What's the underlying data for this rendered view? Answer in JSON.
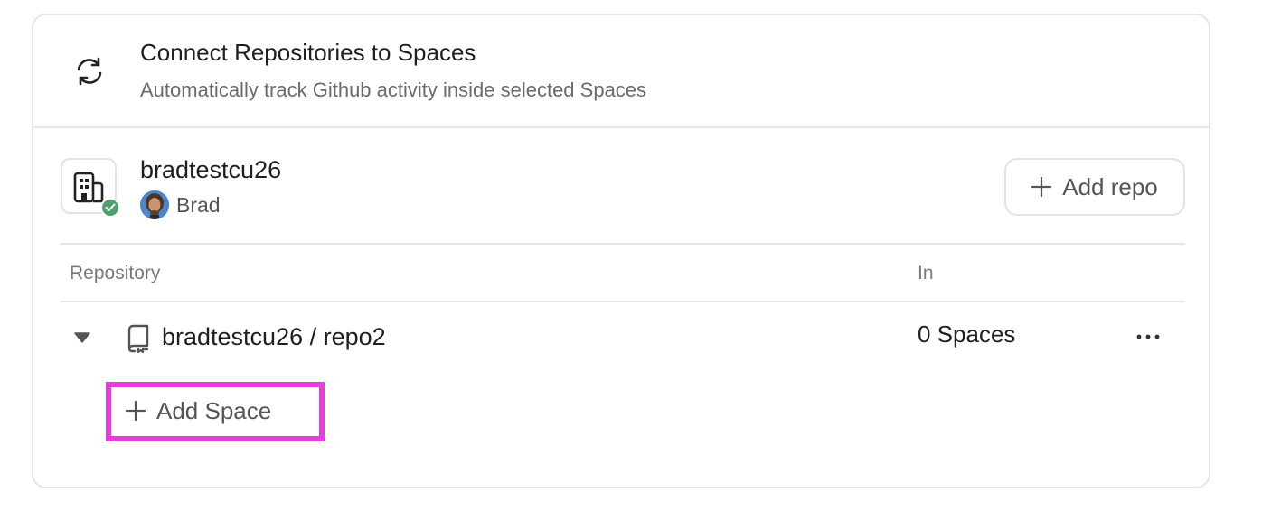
{
  "header": {
    "title": "Connect Repositories to Spaces",
    "subtitle": "Automatically track Github activity inside selected Spaces",
    "icon": "sync-icon"
  },
  "org": {
    "name": "bradtestcu26",
    "owner": "Brad",
    "icon": "building-icon",
    "status": "connected",
    "status_color": "#4fa06a",
    "add_repo_label": "Add repo"
  },
  "table": {
    "columns": [
      "Repository",
      "In"
    ],
    "rows": [
      {
        "repo": "bradtestcu26 / repo2",
        "spaces": "0 Spaces",
        "expanded": true
      }
    ],
    "add_space_label": "Add Space"
  },
  "highlight_color": "#e83ddc"
}
